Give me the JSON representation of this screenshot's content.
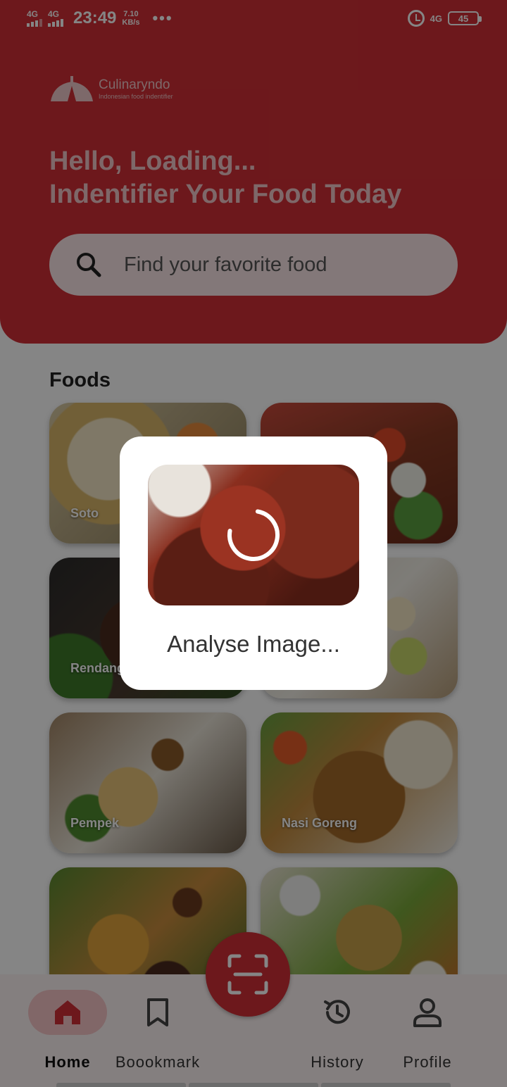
{
  "status_bar": {
    "network1": "4G",
    "network2": "4G",
    "time": "23:49",
    "speed_value": "7.10",
    "speed_unit": "KB/s",
    "more": "•••",
    "network_right": "4G",
    "battery": "45"
  },
  "header": {
    "logo_name": "Culinaryndo",
    "logo_tagline": "Indonesian food indentifier",
    "greeting_line1": "Hello, Loading...",
    "greeting_line2": "Indentifier Your Food Today",
    "search_placeholder": "Find your favorite food"
  },
  "foods": {
    "title": "Foods",
    "items": [
      {
        "label": "Soto"
      },
      {
        "label": ""
      },
      {
        "label": "Rendang"
      },
      {
        "label": ""
      },
      {
        "label": "Pempek"
      },
      {
        "label": "Nasi Goreng"
      },
      {
        "label": ""
      },
      {
        "label": ""
      }
    ]
  },
  "dialog": {
    "message": "Analyse Image..."
  },
  "bottom_nav": {
    "home": "Home",
    "bookmark": "Boookmark",
    "history": "History",
    "profile": "Profile"
  },
  "colors": {
    "primary": "#d12f36",
    "active_pill": "#f8c6c8"
  }
}
